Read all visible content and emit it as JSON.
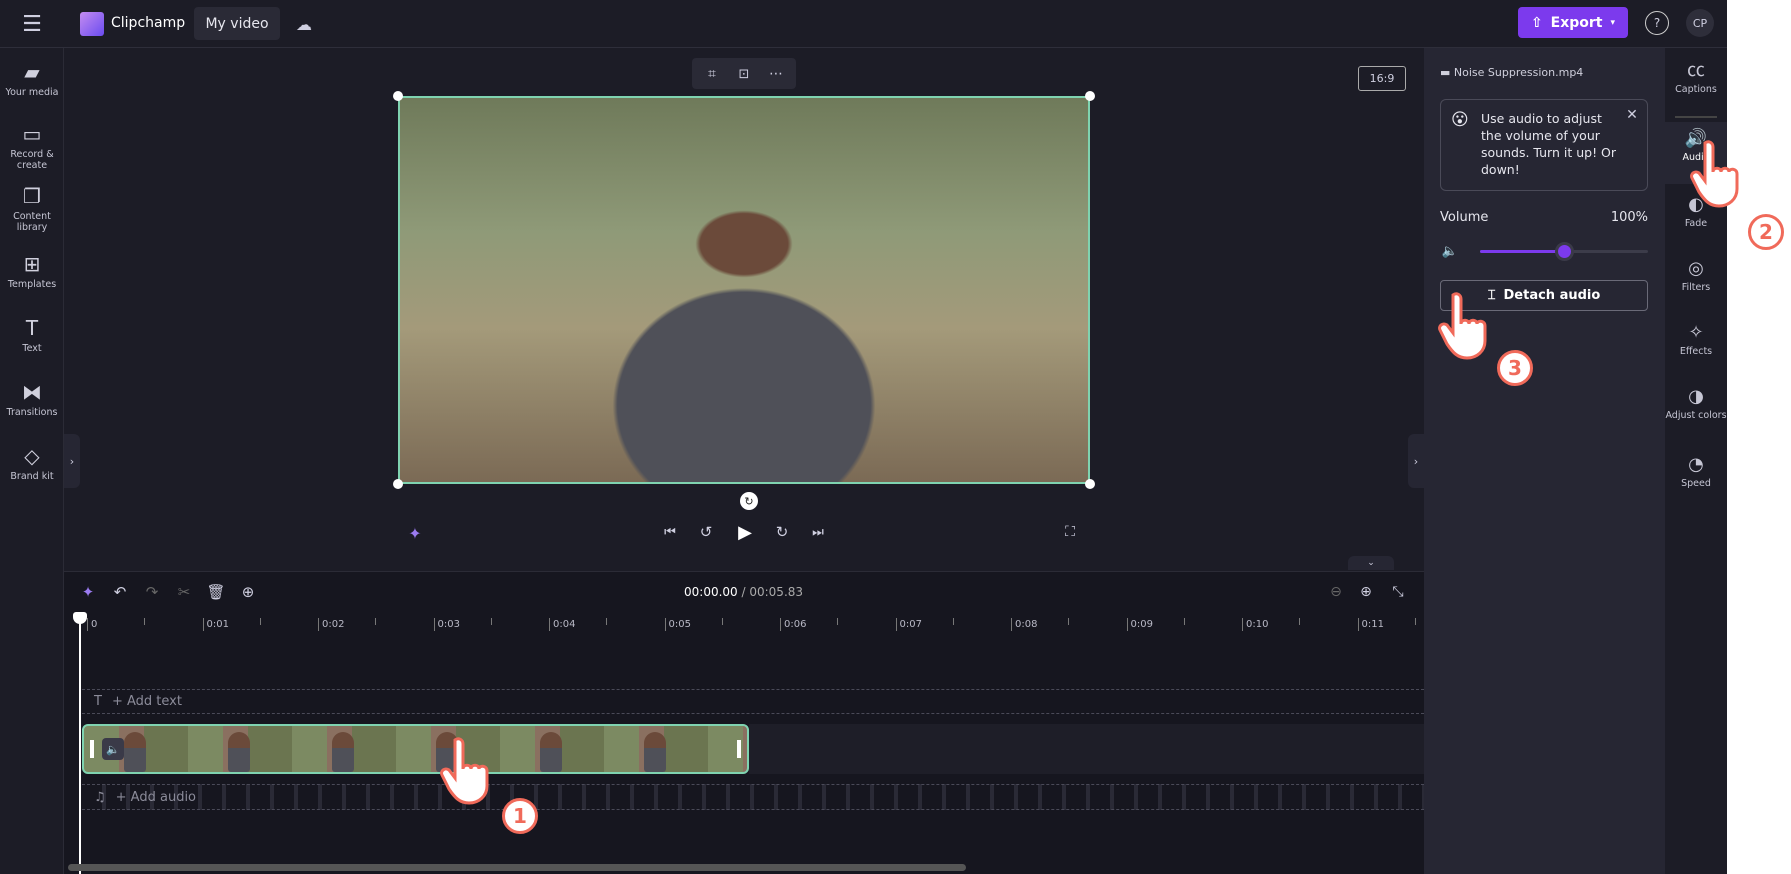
{
  "app": {
    "name": "Clipchamp",
    "project_title": "My video"
  },
  "header": {
    "export_label": "Export",
    "avatar_initials": "CP"
  },
  "sidebar": {
    "items": [
      {
        "label": "Your media",
        "icon": "folder-icon"
      },
      {
        "label": "Record & create",
        "icon": "camera-icon"
      },
      {
        "label": "Content library",
        "icon": "library-icon"
      },
      {
        "label": "Templates",
        "icon": "templates-icon"
      },
      {
        "label": "Text",
        "icon": "text-icon"
      },
      {
        "label": "Transitions",
        "icon": "transitions-icon"
      },
      {
        "label": "Brand kit",
        "icon": "brand-kit-icon"
      }
    ]
  },
  "preview": {
    "aspect_ratio": "16:9"
  },
  "timeline": {
    "current_time": "00:00.00",
    "total_time": "/ 00:05.83",
    "ticks": [
      "0",
      "0:01",
      "0:02",
      "0:03",
      "0:04",
      "0:05",
      "0:06",
      "0:07",
      "0:08",
      "0:09",
      "0:10",
      "0:11"
    ],
    "add_text": "+ Add text",
    "add_audio": "+ Add audio"
  },
  "panel": {
    "file_name": "Noise Suppression.mp4",
    "tip": "Use audio to adjust the volume of your sounds. Turn it up! Or down!",
    "volume_label": "Volume",
    "volume_value": "100%",
    "volume_level": 0.5,
    "detach_label": "Detach audio"
  },
  "right_tabs": [
    {
      "label": "Captions",
      "icon": "captions-icon"
    },
    {
      "label": "Audio",
      "icon": "speaker-icon"
    },
    {
      "label": "Fade",
      "icon": "fade-icon"
    },
    {
      "label": "Filters",
      "icon": "filters-icon"
    },
    {
      "label": "Effects",
      "icon": "effects-icon"
    },
    {
      "label": "Adjust colors",
      "icon": "adjust-colors-icon"
    },
    {
      "label": "Speed",
      "icon": "speed-icon"
    }
  ],
  "steps": [
    "1",
    "2",
    "3"
  ],
  "colors": {
    "accent": "#7c3aed",
    "selection": "#7fd3b0",
    "step": "#f06a5a"
  }
}
